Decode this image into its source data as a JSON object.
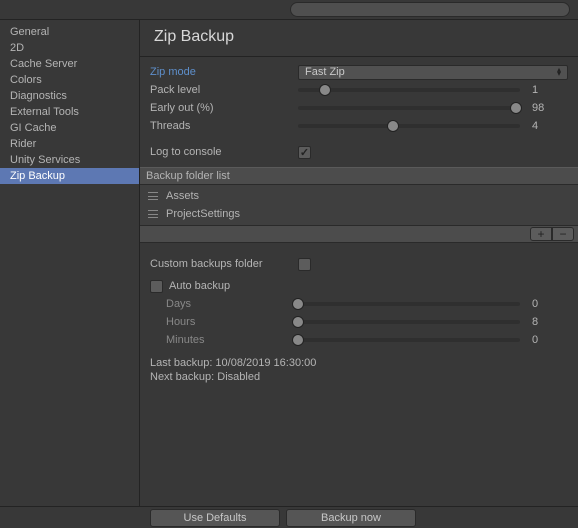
{
  "search": {
    "placeholder": ""
  },
  "sidebar": {
    "items": [
      {
        "label": "General"
      },
      {
        "label": "2D"
      },
      {
        "label": "Cache Server"
      },
      {
        "label": "Colors"
      },
      {
        "label": "Diagnostics"
      },
      {
        "label": "External Tools"
      },
      {
        "label": "GI Cache"
      },
      {
        "label": "Rider"
      },
      {
        "label": "Unity Services"
      },
      {
        "label": "Zip Backup"
      }
    ],
    "selected": 9
  },
  "panel": {
    "title": "Zip Backup",
    "zip_mode": {
      "label": "Zip mode",
      "value": "Fast Zip"
    },
    "pack_level": {
      "label": "Pack level",
      "value": 1,
      "min": 0,
      "max": 9,
      "pct": 12
    },
    "early_out": {
      "label": "Early out (%)",
      "value": 98,
      "min": 0,
      "max": 100,
      "pct": 98
    },
    "threads": {
      "label": "Threads",
      "value": 4,
      "min": 1,
      "max": 8,
      "pct": 43
    },
    "log_to_console": {
      "label": "Log to console",
      "checked": true
    },
    "folder_list": {
      "header": "Backup folder list",
      "items": [
        {
          "label": "Assets"
        },
        {
          "label": "ProjectSettings"
        }
      ]
    },
    "custom_folder": {
      "label": "Custom backups folder",
      "checked": false
    },
    "auto_backup": {
      "label": "Auto backup",
      "checked": false
    },
    "days": {
      "label": "Days",
      "value": 0,
      "pct": 0
    },
    "hours": {
      "label": "Hours",
      "value": 8,
      "pct": 0
    },
    "minutes": {
      "label": "Minutes",
      "value": 0,
      "pct": 0
    },
    "last_backup": "Last backup: 10/08/2019 16:30:00",
    "next_backup": "Next backup: Disabled"
  },
  "buttons": {
    "use_defaults": "Use Defaults",
    "backup_now": "Backup now"
  }
}
